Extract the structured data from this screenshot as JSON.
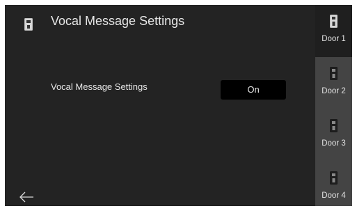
{
  "header": {
    "title": "Vocal Message Settings",
    "icon": "door-station-icon"
  },
  "setting": {
    "label": "Vocal Message Settings",
    "value": "On"
  },
  "footer": {
    "back_icon": "back-arrow-icon"
  },
  "sidebar": {
    "items": [
      {
        "label": "Door 1",
        "icon": "door-station-icon",
        "active": true
      },
      {
        "label": "Door 2",
        "icon": "door-station-icon",
        "active": false
      },
      {
        "label": "Door 3",
        "icon": "door-station-icon",
        "active": false
      },
      {
        "label": "Door 4",
        "icon": "door-station-icon",
        "active": false
      }
    ]
  },
  "colors": {
    "background": "#232323",
    "sidebar": "#444444",
    "active_tab": "#1f1f1f",
    "toggle": "#000000",
    "text": "#e6e6e6"
  }
}
